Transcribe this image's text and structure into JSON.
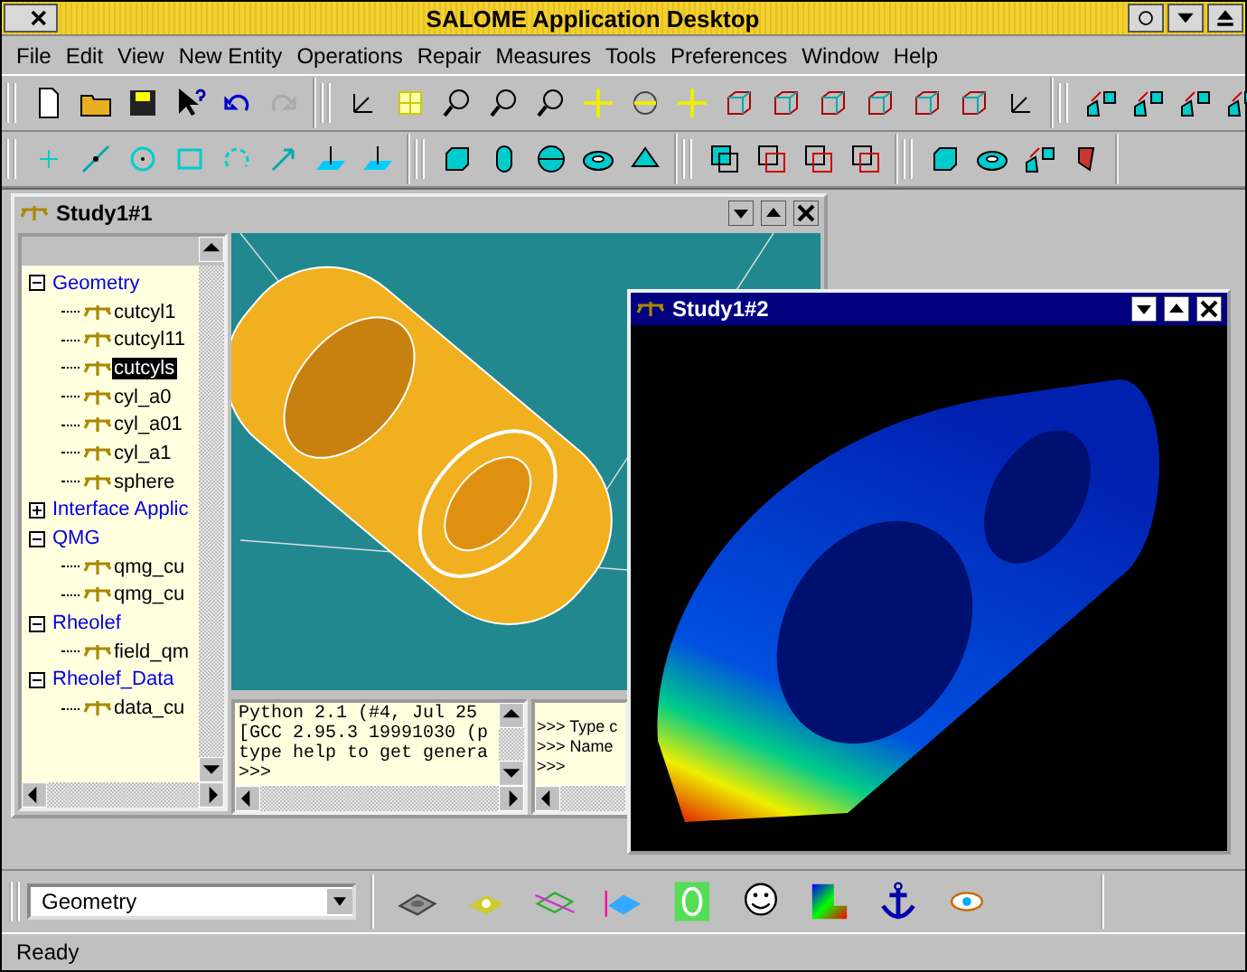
{
  "window": {
    "title": "SALOME Application Desktop"
  },
  "menu": [
    {
      "label": "File"
    },
    {
      "label": "Edit"
    },
    {
      "label": "View"
    },
    {
      "label": "New Entity"
    },
    {
      "label": "Operations"
    },
    {
      "label": "Repair"
    },
    {
      "label": "Measures"
    },
    {
      "label": "Tools"
    },
    {
      "label": "Preferences"
    },
    {
      "label": "Window"
    },
    {
      "label": "Help"
    }
  ],
  "study_windows": [
    {
      "title": "Study1#1",
      "active": false,
      "tree": [
        {
          "label": "Geometry",
          "expanded": true,
          "selected": false,
          "children": [
            {
              "label": "cutcyl1",
              "selected": false
            },
            {
              "label": "cutcyl11",
              "selected": false
            },
            {
              "label": "cutcyls",
              "selected": true
            },
            {
              "label": "cyl_a0",
              "selected": false
            },
            {
              "label": "cyl_a01",
              "selected": false
            },
            {
              "label": "cyl_a1",
              "selected": false
            },
            {
              "label": "sphere",
              "selected": false
            }
          ]
        },
        {
          "label": "Interface Applic",
          "expanded": false,
          "selected": false
        },
        {
          "label": "QMG",
          "expanded": true,
          "selected": false,
          "children": [
            {
              "label": "qmg_cu",
              "selected": false
            },
            {
              "label": "qmg_cu",
              "selected": false
            }
          ]
        },
        {
          "label": "Rheolef",
          "expanded": true,
          "selected": false,
          "children": [
            {
              "label": "field_qm",
              "selected": false
            }
          ]
        },
        {
          "label": "Rheolef_Data",
          "expanded": true,
          "selected": false,
          "children": [
            {
              "label": "data_cu",
              "selected": false
            }
          ]
        }
      ],
      "console": {
        "lines": [
          "Python 2.1 (#4, Jul 25",
          "[GCC 2.95.3 19991030 (p",
          "type help to get genera",
          ">>>"
        ]
      },
      "console_2": {
        "lines": [
          ">>> Type c",
          ">>> Name",
          ">>>"
        ]
      }
    },
    {
      "title": "Study1#2",
      "active": true
    }
  ],
  "module_selector": {
    "value": "Geometry"
  },
  "status_bar": {
    "text": "Ready"
  }
}
